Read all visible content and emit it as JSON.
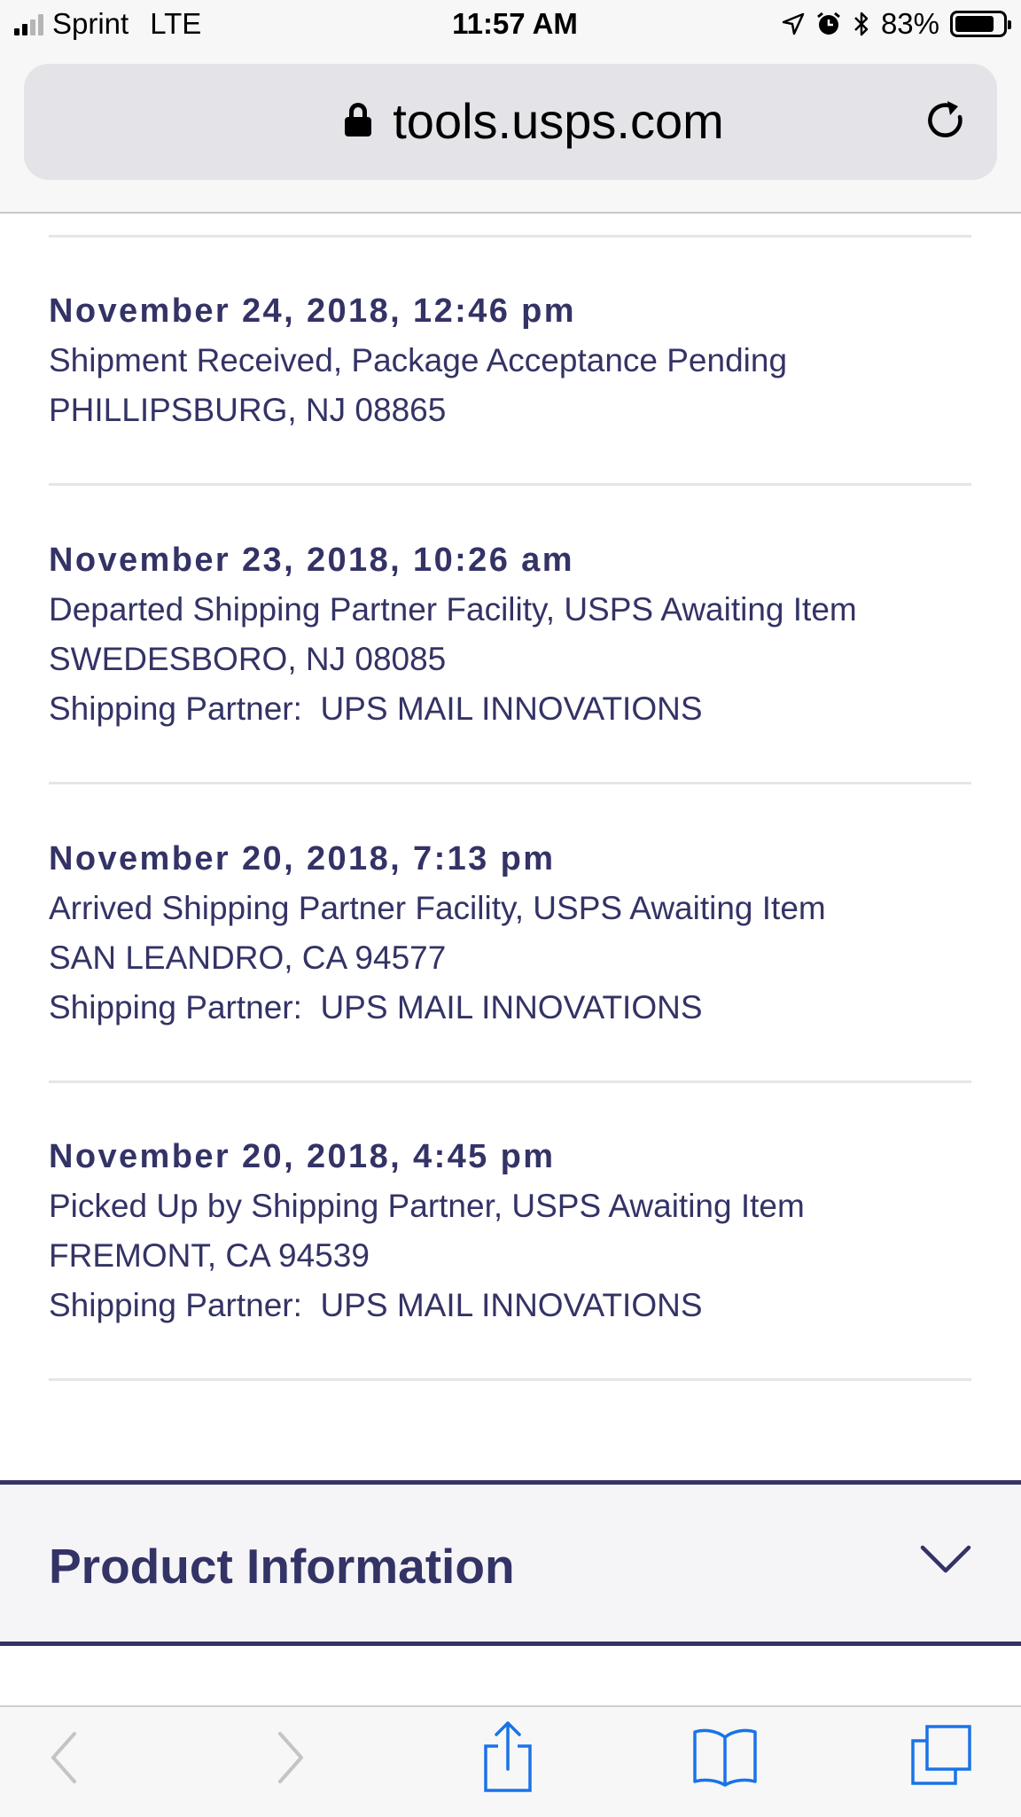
{
  "status_bar": {
    "carrier": "Sprint",
    "network": "LTE",
    "time": "11:57 AM",
    "battery_percent": "83%",
    "battery_level": 0.83,
    "icons": [
      "signal-icon",
      "location-arrow-icon",
      "alarm-icon",
      "bluetooth-icon",
      "battery-icon"
    ]
  },
  "browser": {
    "url": "tools.usps.com",
    "icons": [
      "lock-icon",
      "reload-icon"
    ]
  },
  "tracking_events": [
    {
      "date": "November 24, 2018, 12:46 pm",
      "status": "Shipment Received, Package Acceptance Pending",
      "location": "PHILLIPSBURG, NJ 08865"
    },
    {
      "date": "November 23, 2018, 10:26 am",
      "status": "Departed Shipping Partner Facility, USPS Awaiting Item",
      "location": "SWEDESBORO, NJ 08085",
      "partner": "Shipping Partner:  UPS MAIL INNOVATIONS"
    },
    {
      "date": "November 20, 2018, 7:13 pm",
      "status": "Arrived Shipping Partner Facility, USPS Awaiting Item",
      "location": "SAN LEANDRO, CA 94577",
      "partner": "Shipping Partner:  UPS MAIL INNOVATIONS"
    },
    {
      "date": "November 20, 2018, 4:45 pm",
      "status": "Picked Up by Shipping Partner, USPS Awaiting Item",
      "location": "FREMONT, CA 94539",
      "partner": "Shipping Partner:  UPS MAIL INNOVATIONS"
    }
  ],
  "product_information": {
    "title": "Product Information",
    "icon": "chevron-down-icon"
  },
  "toolbar": {
    "icons": [
      "back-icon",
      "forward-icon",
      "share-icon",
      "bookmarks-icon",
      "tabs-icon"
    ]
  },
  "colors": {
    "usps_navy": "#333366",
    "ios_blue": "#1a73e8",
    "disabled_gray": "#c4c4c8"
  }
}
